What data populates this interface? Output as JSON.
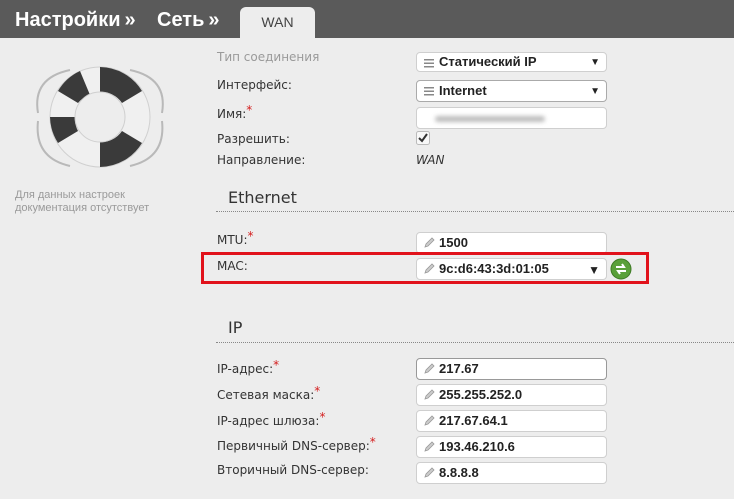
{
  "breadcrumb": {
    "settings": "Настройки",
    "network": "Сеть",
    "separator": "»"
  },
  "active_tab": "WAN",
  "left_panel": {
    "no_docs_text": "Для данных настроек документация отсутствует"
  },
  "form": {
    "connection_type_label": "Тип соединения",
    "connection_type_value": "Статический IP",
    "interface_label": "Интерфейс:",
    "interface_value": "Internet",
    "name_label": "Имя:",
    "enable_label": "Разрешить:",
    "enable_checked": true,
    "direction_label": "Направление:",
    "direction_value": "WAN",
    "required_mark": "*"
  },
  "ethernet": {
    "section_title": "Ethernet",
    "mtu_label": "MTU:",
    "mtu_value": "1500",
    "mac_label": "MAC:",
    "mac_value": "9c:d6:43:3d:01:05"
  },
  "ip": {
    "section_title": "IP",
    "ip_label": "IP-адрес:",
    "ip_value": "217.67",
    "mask_label": "Сетевая маска:",
    "mask_value": "255.255.252.0",
    "gateway_label": "IP-адрес шлюза:",
    "gateway_value": "217.67.64.1",
    "dns1_label": "Первичный DNS-сервер:",
    "dns1_value": "193.46.210.6",
    "dns2_label": "Вторичный DNS-сервер:",
    "dns2_value": "8.8.8.8"
  },
  "colors": {
    "header_bg": "#5a5a5a",
    "highlight_border": "#e1121b",
    "required_mark": "#d41d1d",
    "refresh_button": "#5aa03a"
  },
  "icons": {
    "logo": "lifebuoy-icon",
    "edit": "pencil-icon",
    "list": "list-icon",
    "dropdown": "caret-down-icon",
    "refresh": "refresh-icon",
    "checkbox": "checkbox-icon"
  }
}
